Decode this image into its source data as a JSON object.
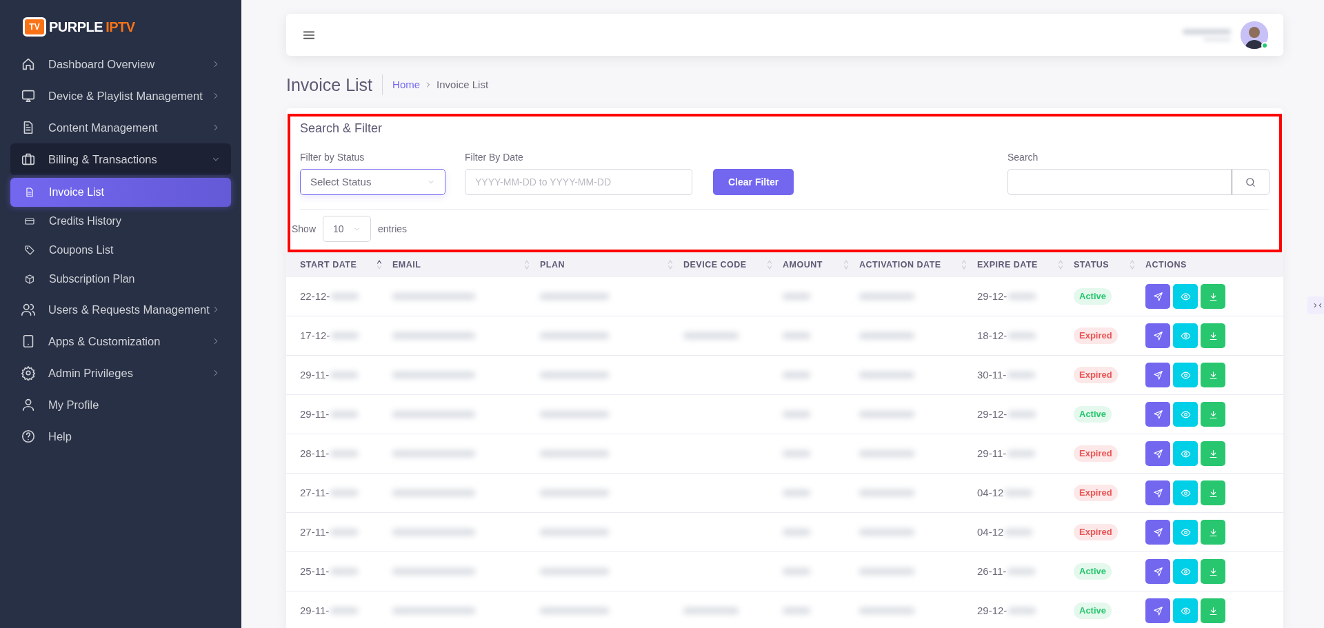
{
  "brand": {
    "badge": "TV",
    "name": "PURPLE",
    "accent": "IPTV"
  },
  "sidebar": {
    "items": [
      {
        "label": "Dashboard Overview",
        "kind": "group",
        "expanded": false,
        "selected": false
      },
      {
        "label": "Device & Playlist Management",
        "kind": "group",
        "expanded": false,
        "selected": false
      },
      {
        "label": "Content Management",
        "kind": "group",
        "expanded": false,
        "selected": false
      },
      {
        "label": "Billing & Transactions",
        "kind": "group",
        "expanded": true,
        "selected": false,
        "children": [
          {
            "label": "Invoice List",
            "selected": true
          },
          {
            "label": "Credits History",
            "selected": false
          },
          {
            "label": "Coupons List",
            "selected": false
          },
          {
            "label": "Subscription Plan",
            "selected": false
          }
        ]
      },
      {
        "label": "Users & Requests Management",
        "kind": "group",
        "expanded": false,
        "selected": false
      },
      {
        "label": "Apps & Customization",
        "kind": "group",
        "expanded": false,
        "selected": false
      },
      {
        "label": "Admin Privileges",
        "kind": "group",
        "expanded": false,
        "selected": false
      },
      {
        "label": "My Profile",
        "kind": "link",
        "selected": false
      },
      {
        "label": "Help",
        "kind": "link",
        "selected": false
      }
    ]
  },
  "header": {
    "user": {
      "online": true
    }
  },
  "page_title": "Invoice List",
  "breadcrumb": [
    "Home",
    "Invoice List"
  ],
  "filter": {
    "title": "Search & Filter",
    "highlighted": true,
    "status_filter": {
      "label": "Filter by Status",
      "value": "Select Status"
    },
    "date_filter": {
      "label": "Filter By Date",
      "placeholder": "YYYY-MM-DD to YYYY-MM-DD"
    },
    "clear_button": "Clear Filter",
    "search": {
      "label": "Search"
    },
    "entries": {
      "before": "Show",
      "value": "10",
      "after": "entries"
    }
  },
  "table": {
    "columns": [
      {
        "label": "START DATE",
        "sortable": true,
        "sorted": true
      },
      {
        "label": "EMAIL",
        "sortable": true,
        "sorted": false
      },
      {
        "label": "PLAN",
        "sortable": true,
        "sorted": false
      },
      {
        "label": "DEVICE CODE",
        "sortable": true,
        "sorted": false
      },
      {
        "label": "AMOUNT",
        "sortable": true,
        "sorted": false
      },
      {
        "label": "ACTIVATION DATE",
        "sortable": true,
        "sorted": false
      },
      {
        "label": "EXPIRE DATE",
        "sortable": true,
        "sorted": false
      },
      {
        "label": "STATUS",
        "sortable": true,
        "sorted": false
      },
      {
        "label": "ACTIONS",
        "sortable": false
      }
    ],
    "rows": [
      {
        "start_date": "22-12-",
        "expire_date": "29-12-",
        "status": "Active",
        "kind": "active",
        "device_code_redacted": false
      },
      {
        "start_date": "17-12-",
        "expire_date": "18-12-",
        "status": "Expired",
        "kind": "expired",
        "device_code_redacted": true
      },
      {
        "start_date": "29-11-",
        "expire_date": "30-11-",
        "status": "Expired",
        "kind": "expired",
        "device_code_redacted": false
      },
      {
        "start_date": "29-11-",
        "expire_date": "29-12-",
        "status": "Active",
        "kind": "active",
        "device_code_redacted": false
      },
      {
        "start_date": "28-11-",
        "expire_date": "29-11-",
        "status": "Expired",
        "kind": "expired",
        "device_code_redacted": false
      },
      {
        "start_date": "27-11-",
        "expire_date": "04-12",
        "status": "Expired",
        "kind": "expired",
        "device_code_redacted": false
      },
      {
        "start_date": "27-11-",
        "expire_date": "04-12",
        "status": "Expired",
        "kind": "expired",
        "device_code_redacted": false
      },
      {
        "start_date": "25-11-",
        "expire_date": "26-11-",
        "status": "Active",
        "kind": "active",
        "device_code_redacted": false
      },
      {
        "start_date": "29-11-",
        "expire_date": "29-12-",
        "status": "Active",
        "kind": "active",
        "device_code_redacted": true
      }
    ]
  }
}
